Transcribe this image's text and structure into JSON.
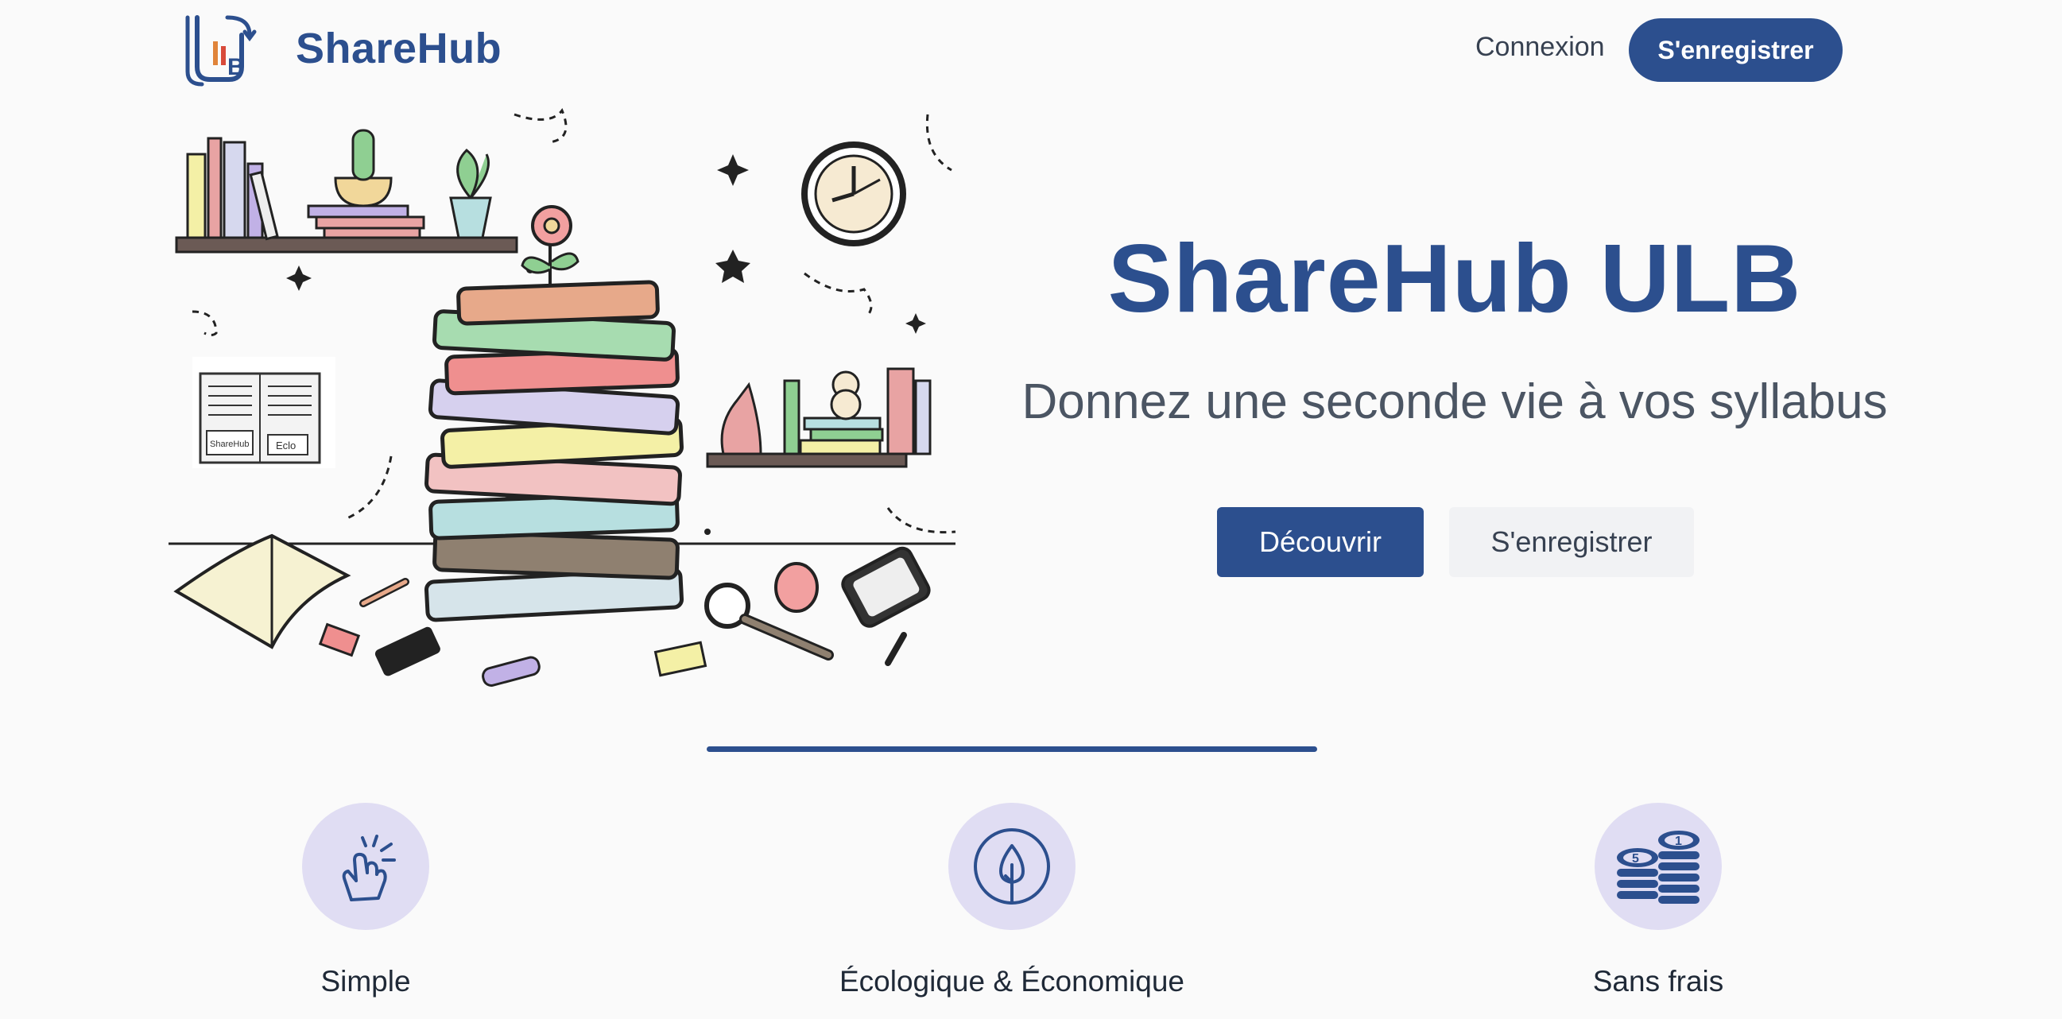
{
  "header": {
    "brand": "ShareHub",
    "logo_text": "ULB",
    "login": "Connexion",
    "register": "S'enregistrer"
  },
  "illustration": {
    "note_labels": [
      "ShareHub",
      "Eclo"
    ]
  },
  "hero": {
    "title": "ShareHub ULB",
    "subtitle": "Donnez une seconde vie à vos syllabus",
    "discover_button": "Découvrir",
    "register_button": "S'enregistrer"
  },
  "features": [
    {
      "label": "Simple",
      "icon": "hand-tap-icon"
    },
    {
      "label": "Écologique & Économique",
      "icon": "leaf-drop-icon"
    },
    {
      "label": "Sans frais",
      "icon": "coins-icon"
    }
  ],
  "colors": {
    "primary": "#2c4f8e",
    "icon_bg": "#e0ddf3",
    "page_bg": "#fafafa"
  }
}
